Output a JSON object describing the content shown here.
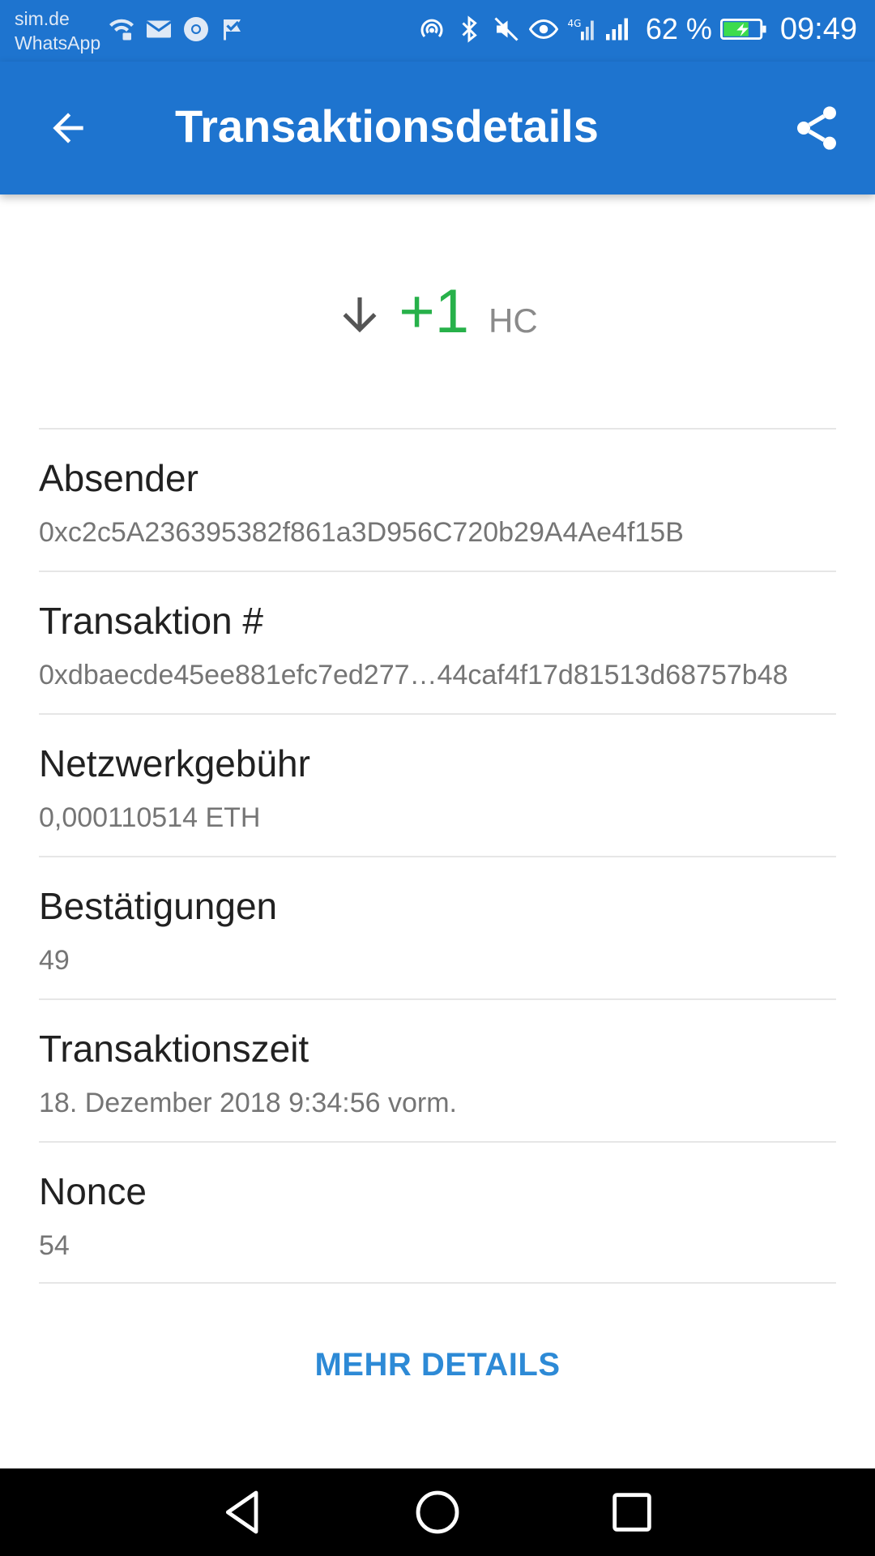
{
  "status_bar": {
    "carrier_line1": "sim.de",
    "carrier_line2": "WhatsApp",
    "notification_icons": [
      "wifi-lock-icon",
      "mail-icon",
      "chrome-icon",
      "check-flag-icon"
    ],
    "system_icons": [
      "hotspot-icon",
      "bluetooth-icon",
      "mute-icon",
      "eye-icon",
      "signal-4g-icon",
      "signal-icon"
    ],
    "battery_percent": "62 %",
    "time": "09:49"
  },
  "app_bar": {
    "title": "Transaktionsdetails",
    "back_icon": "arrow-back-icon",
    "share_icon": "share-icon",
    "color": "#1e74cf"
  },
  "amount": {
    "direction_icon": "arrow-down-icon",
    "value": "+1",
    "unit": "HC",
    "value_color": "#27b14a"
  },
  "details": [
    {
      "label": "Absender",
      "value": "0xc2c5A236395382f861a3D956C720b29A4Ae4f15B"
    },
    {
      "label": "Transaktion #",
      "value": "0xdbaecde45ee881efc7ed277…44caf4f17d81513d68757b48"
    },
    {
      "label": "Netzwerkgebühr",
      "value": "0,000110514 ETH"
    },
    {
      "label": "Bestätigungen",
      "value": "49"
    },
    {
      "label": "Transaktionszeit",
      "value": "18. Dezember 2018 9:34:56 vorm."
    },
    {
      "label": "Nonce",
      "value": "54"
    }
  ],
  "more_details_label": "MEHR DETAILS",
  "nav_bar": {
    "back_icon": "nav-back-icon",
    "home_icon": "nav-home-icon",
    "recents_icon": "nav-recents-icon"
  }
}
